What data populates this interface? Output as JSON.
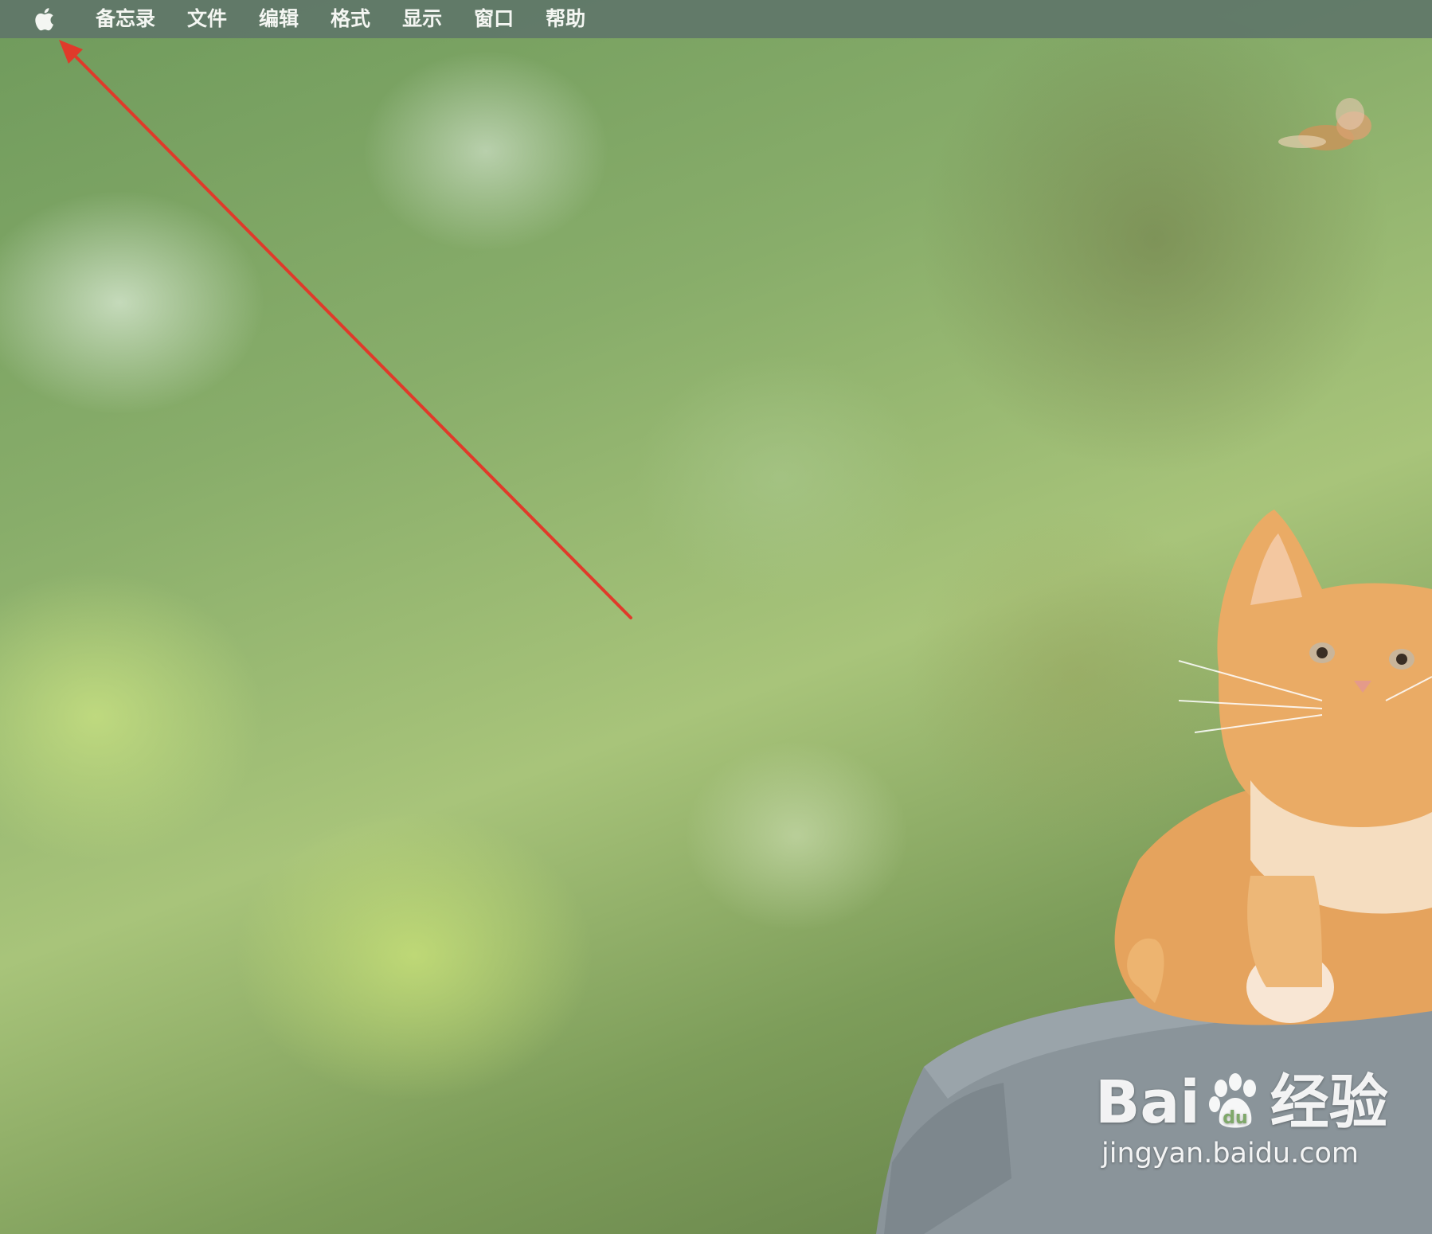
{
  "menubar": {
    "apple_icon": "apple-logo-icon",
    "items": [
      {
        "label": "备忘录"
      },
      {
        "label": "文件"
      },
      {
        "label": "编辑"
      },
      {
        "label": "格式"
      },
      {
        "label": "显示"
      },
      {
        "label": "窗口"
      },
      {
        "label": "帮助"
      }
    ]
  },
  "annotation": {
    "arrow_color": "#e03a2a",
    "points_to": "apple-logo-icon"
  },
  "watermark": {
    "brand_prefix": "Bai",
    "brand_suffix": "经验",
    "url": "jingyan.baidu.com",
    "paw_icon": "baidu-paw-icon"
  },
  "colors": {
    "menubar_bg": "#5f7669",
    "menubar_text": "#f4f6f2",
    "cat_fur": "#e9a560"
  }
}
